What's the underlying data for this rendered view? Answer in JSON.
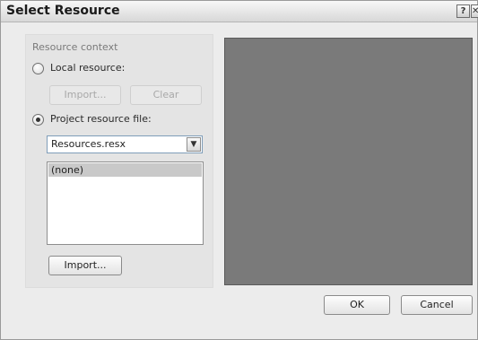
{
  "window": {
    "title": "Select Resource",
    "help_glyph": "?",
    "close_glyph": "✕"
  },
  "resource_context": {
    "label": "Resource context",
    "local": {
      "label": "Local resource:",
      "selected": false,
      "import_label": "Import...",
      "clear_label": "Clear"
    },
    "project": {
      "label": "Project resource file:",
      "selected": true,
      "file_value": "Resources.resx",
      "list_items": [
        "(none)"
      ],
      "import_label": "Import..."
    }
  },
  "footer": {
    "ok_label": "OK",
    "cancel_label": "Cancel"
  },
  "colors": {
    "preview_bg": "#7a7a7a",
    "dialog_bg": "#ececec"
  }
}
